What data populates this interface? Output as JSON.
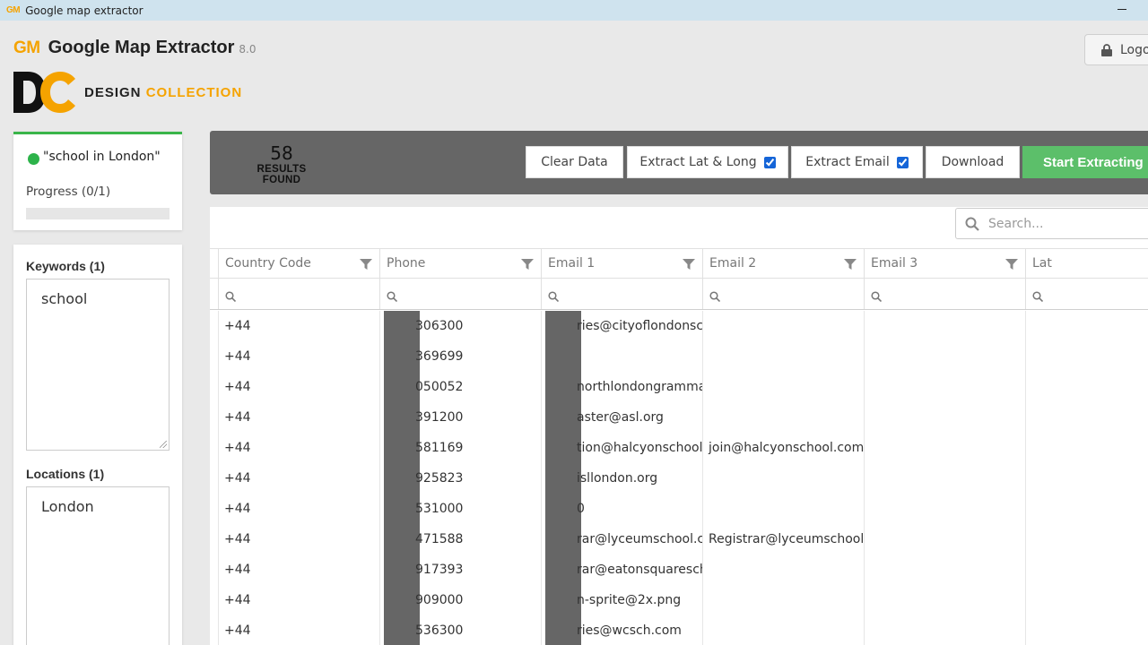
{
  "window": {
    "icon_text": "GM",
    "title": "Google map extractor"
  },
  "app": {
    "logo": "GM",
    "name": "Google Map Extractor",
    "version": "8.0"
  },
  "brand": {
    "word1": "DESIGN",
    "word2": "COLLECTION"
  },
  "logout": {
    "label": "Logo"
  },
  "status": {
    "query": "\"school in London\"",
    "progress_label": "Progress (0/1)",
    "progress": 0
  },
  "keywords": {
    "label": "Keywords (1)",
    "value": "school"
  },
  "locations": {
    "label": "Locations (1)",
    "value": "London"
  },
  "results": {
    "count": "58",
    "label": "RESULTS FOUND"
  },
  "toolbar": {
    "clear": "Clear Data",
    "extract_latlong": "Extract Lat & Long",
    "extract_latlong_checked": true,
    "extract_email": "Extract Email",
    "extract_email_checked": true,
    "download": "Download",
    "start": "Start Extracting"
  },
  "search": {
    "placeholder": "Search..."
  },
  "columns": [
    "Country Code",
    "Phone",
    "Email 1",
    "Email 2",
    "Email 3",
    "Lat"
  ],
  "rows": [
    {
      "country": "+44",
      "phone": "306300",
      "email1": "ries@cityoflondonsch",
      "email2": ""
    },
    {
      "country": "+44",
      "phone": "369699",
      "email1": "",
      "email2": ""
    },
    {
      "country": "+44",
      "phone": "050052",
      "email1": "northlondongrammar",
      "email2": ""
    },
    {
      "country": "+44",
      "phone": "391200",
      "email1": "aster@asl.org",
      "email2": ""
    },
    {
      "country": "+44",
      "phone": "581169",
      "email1": "tion@halcyonschool.",
      "email2": "join@halcyonschool.com"
    },
    {
      "country": "+44",
      "phone": "925823",
      "email1": "isllondon.org",
      "email2": ""
    },
    {
      "country": "+44",
      "phone": "531000",
      "email1": "0",
      "email2": ""
    },
    {
      "country": "+44",
      "phone": "471588",
      "email1": "rar@lyceumschool.co",
      "email2": "Registrar@lyceumschool.co"
    },
    {
      "country": "+44",
      "phone": "917393",
      "email1": "rar@eatonsquaresch",
      "email2": ""
    },
    {
      "country": "+44",
      "phone": "909000",
      "email1": "n-sprite@2x.png",
      "email2": ""
    },
    {
      "country": "+44",
      "phone": "536300",
      "email1": "ries@wcsch.com",
      "email2": ""
    }
  ]
}
